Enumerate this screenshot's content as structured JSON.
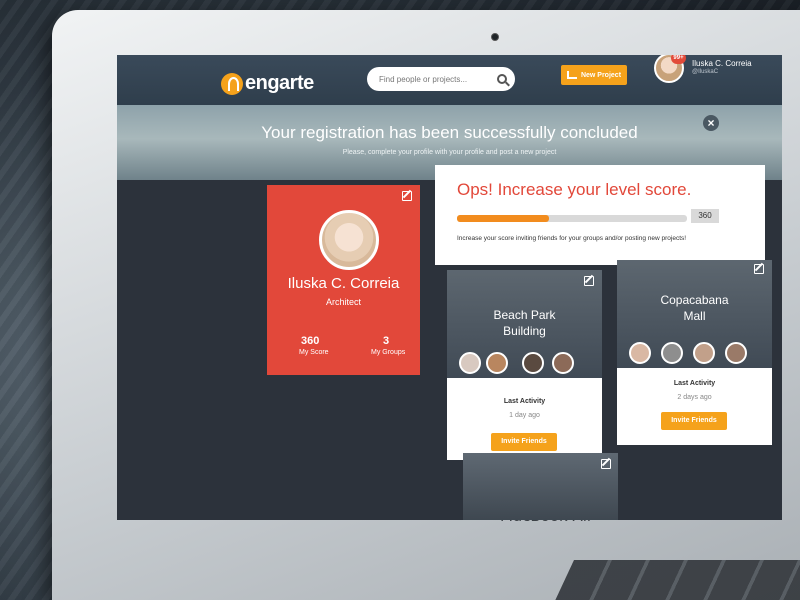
{
  "app": {
    "logo_text": "engarte"
  },
  "header": {
    "search_placeholder": "Find people or projects...",
    "new_project_label": "New Project",
    "notification_count": "99+",
    "user_name": "Iluska C. Correia",
    "user_handle": "@IluskaC"
  },
  "banner": {
    "title": "Your registration has been successfully concluded",
    "subtitle": "Please, complete your profile with your profile and post a new project"
  },
  "profile": {
    "name": "Iluska C. Correia",
    "role": "Architect",
    "score_value": "360",
    "score_label": "My Score",
    "groups_value": "3",
    "groups_label": "My Groups"
  },
  "score": {
    "title": "Ops! Increase your level score.",
    "value": "360",
    "progress_fraction": 0.4,
    "hint": "Increase your score inviting friends for your groups and/or posting new projects!"
  },
  "projects": [
    {
      "name_line1": "Beach Park",
      "name_line2": "Building",
      "last_activity_label": "Last Activity",
      "last_activity_time": "1 day ago",
      "invite_label": "Invite Friends"
    },
    {
      "name_line1": "Copacabana",
      "name_line2": "Mall",
      "last_activity_label": "Last Activity",
      "last_activity_time": "2 days ago",
      "invite_label": "Invite Friends"
    }
  ],
  "device": {
    "label": "MacBook Air"
  },
  "colors": {
    "accent_orange": "#f5a21b",
    "profile_red": "#e2483a",
    "dark_bg": "#2c323b"
  }
}
